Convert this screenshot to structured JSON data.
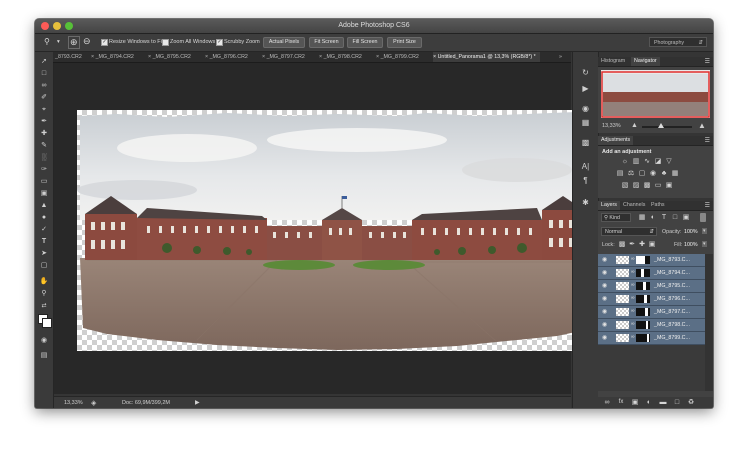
{
  "app": {
    "title": "Adobe Photoshop CS6"
  },
  "options_bar": {
    "resize_windows_label": "Resize Windows to Fit",
    "zoom_all_label": "Zoom All Windows",
    "scrubby_zoom_label": "Scrubby Zoom",
    "actual_pixels": "Actual Pixels",
    "fit_screen": "Fit Screen",
    "fill_screen": "Fill Screen",
    "print_size": "Print Size",
    "workspace": "Photography",
    "checked": {
      "resize_windows": true,
      "zoom_all": false,
      "scrubby_zoom": true
    }
  },
  "doc_tabs": [
    {
      "label": "_8793.CR2"
    },
    {
      "label": "_MG_8794.CR2"
    },
    {
      "label": "_MG_8795.CR2"
    },
    {
      "label": "_MG_8796.CR2"
    },
    {
      "label": "_MG_8797.CR2"
    },
    {
      "label": "_MG_8798.CR2"
    },
    {
      "label": "_MG_8799.CR2"
    },
    {
      "label": "Untitled_Panorama1 @ 13,3% (RGB/8*) *"
    }
  ],
  "status_bar": {
    "zoom": "13,33%",
    "doc_size": "Doc: 69,9M/399,2M"
  },
  "navigator": {
    "tabs": [
      "Histogram",
      "Navigator"
    ],
    "zoom": "13,33%"
  },
  "adjustments": {
    "tab": "Adjustments",
    "heading": "Add an adjustment"
  },
  "layers": {
    "tabs": [
      "Layers",
      "Channels",
      "Paths"
    ],
    "filter_kind": "Kind",
    "blend_mode": "Normal",
    "opacity_label": "Opacity:",
    "opacity": "100%",
    "lock_label": "Lock:",
    "fill_label": "Fill:",
    "fill": "100%",
    "items": [
      {
        "name": "_MG_8793.C..."
      },
      {
        "name": "_MG_8794.C..."
      },
      {
        "name": "_MG_8795.C..."
      },
      {
        "name": "_MG_8796.C..."
      },
      {
        "name": "_MG_8797.C..."
      },
      {
        "name": "_MG_8798.C..."
      },
      {
        "name": "_MG_8799.C..."
      }
    ]
  },
  "colors": {
    "accent": "#5b6f86",
    "panel": "#424242",
    "chrome": "#353535"
  }
}
